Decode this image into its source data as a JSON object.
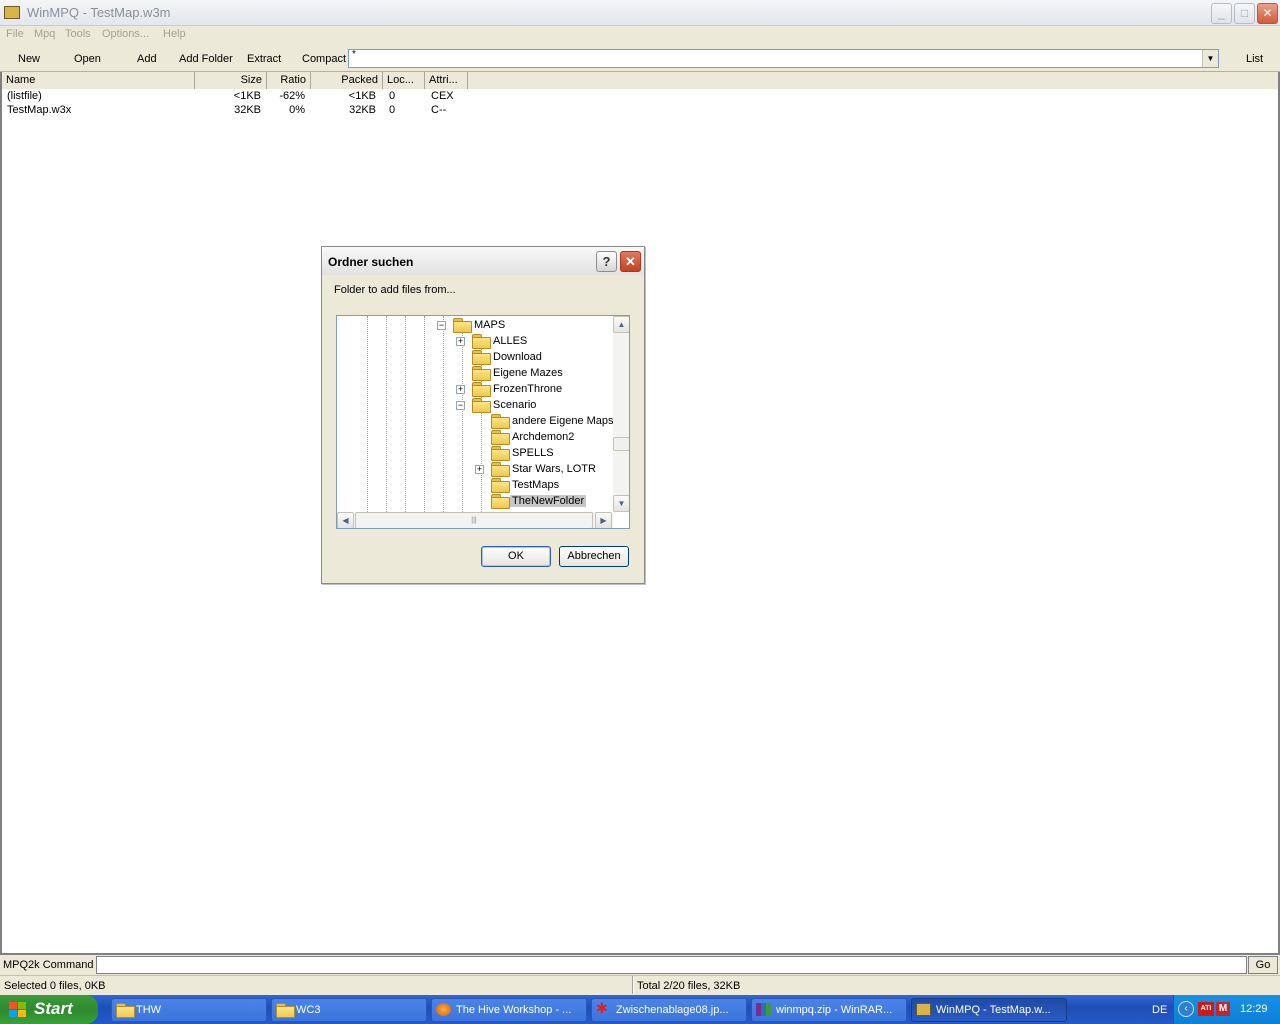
{
  "window": {
    "title": "WinMPQ - TestMap.w3m",
    "min": "_",
    "max": "□",
    "close": "✕"
  },
  "menu": [
    "File",
    "Mpq",
    "Tools",
    "Options...",
    "Help"
  ],
  "toolbar": {
    "new": "New",
    "open": "Open",
    "add": "Add",
    "add_folder": "Add Folder",
    "extract": "Extract",
    "compact": "Compact",
    "filter_value": "*",
    "list": "List"
  },
  "list": {
    "headers": [
      "Name",
      "Size",
      "Ratio",
      "Packed",
      "Loc...",
      "Attri..."
    ],
    "rows": [
      {
        "name": "(listfile)",
        "size": "<1KB",
        "ratio": "-62%",
        "packed": "<1KB",
        "loc": "0",
        "attr": "CEX"
      },
      {
        "name": "TestMap.w3x",
        "size": "32KB",
        "ratio": "0%",
        "packed": "32KB",
        "loc": "0",
        "attr": "C--"
      }
    ]
  },
  "dialog": {
    "title": "Ordner suchen",
    "help": "?",
    "close": "✕",
    "prompt": "Folder to add files from...",
    "tree": [
      {
        "label": "MAPS",
        "expander": "−"
      },
      {
        "label": "ALLES",
        "expander": "+"
      },
      {
        "label": "Download",
        "expander": ""
      },
      {
        "label": "Eigene Mazes",
        "expander": ""
      },
      {
        "label": "FrozenThrone",
        "expander": "+"
      },
      {
        "label": "Scenario",
        "expander": "−"
      },
      {
        "label": "andere Eigene Maps",
        "expander": ""
      },
      {
        "label": "Archdemon2",
        "expander": ""
      },
      {
        "label": "SPELLS",
        "expander": ""
      },
      {
        "label": "Star Wars, LOTR",
        "expander": "+"
      },
      {
        "label": "TestMaps",
        "expander": ""
      },
      {
        "label": "TheNewFolder",
        "expander": ""
      }
    ],
    "ok": "OK",
    "cancel": "Abbrechen"
  },
  "command": {
    "label": "MPQ2k Command",
    "go": "Go"
  },
  "status": {
    "selected": "Selected 0 files, 0KB",
    "total": "Total 2/20 files, 32KB"
  },
  "taskbar": {
    "start": "Start",
    "tasks": [
      "THW",
      "WC3",
      "The Hive Workshop - ...",
      "Zwischenablage08.jp...",
      "winmpq.zip - WinRAR...",
      "WinMPQ - TestMap.w..."
    ],
    "lang": "DE",
    "clock": "12:29"
  }
}
